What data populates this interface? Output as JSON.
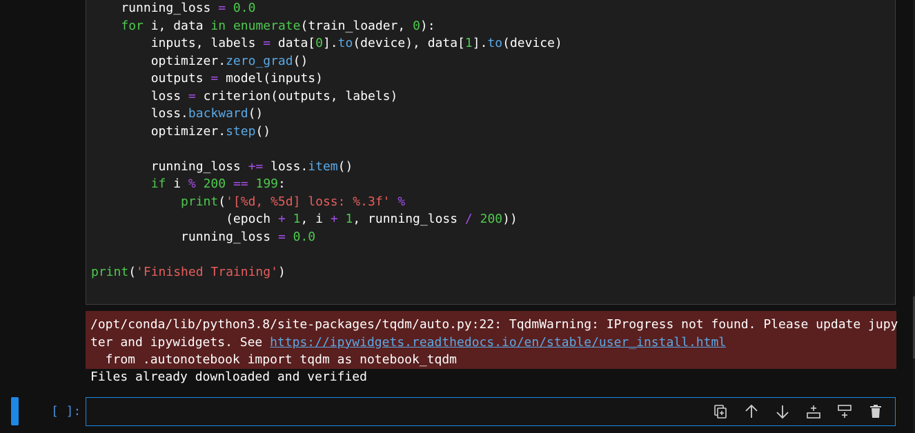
{
  "code_cell": {
    "lines": [
      "running_loss = 0.0",
      "for i, data in enumerate(train_loader, 0):",
      "inputs, labels = data[0].to(device), data[1].to(device)",
      "optimizer.zero_grad()",
      "outputs = model(inputs)",
      "loss = criterion(outputs, labels)",
      "loss.backward()",
      "optimizer.step()",
      "",
      "running_loss += loss.item()",
      "if i % 200 == 199:",
      "print('[%d, %5d] loss: %.3f' %",
      "(epoch + 1, i + 1, running_loss / 200))",
      "running_loss = 0.0",
      "",
      "print('Finished Training')"
    ]
  },
  "output": {
    "stderr_line1": "/opt/conda/lib/python3.8/site-packages/tqdm/auto.py:22: TqdmWarning: IProgress not found. Please update jupy",
    "stderr_line2_prefix": "ter and ipywidgets. See ",
    "stderr_link": "https://ipywidgets.readthedocs.io/en/stable/user_install.html",
    "stderr_line3": "  from .autonotebook import tqdm as notebook_tqdm",
    "stdout": "Files already downloaded and verified"
  },
  "active_cell": {
    "prompt": "[ ]:",
    "toolbar": [
      {
        "icon": "duplicate-icon"
      },
      {
        "icon": "arrow-up-icon"
      },
      {
        "icon": "arrow-down-icon"
      },
      {
        "icon": "insert-above-icon"
      },
      {
        "icon": "insert-below-icon"
      },
      {
        "icon": "trash-icon"
      }
    ]
  },
  "colors": {
    "accent": "#1e88e5",
    "stderr_bg": "#5a1f1f",
    "keyword": "#4ec94e",
    "operator": "#a64ee8",
    "function": "#5aa9e6",
    "string": "#e85d5d"
  }
}
